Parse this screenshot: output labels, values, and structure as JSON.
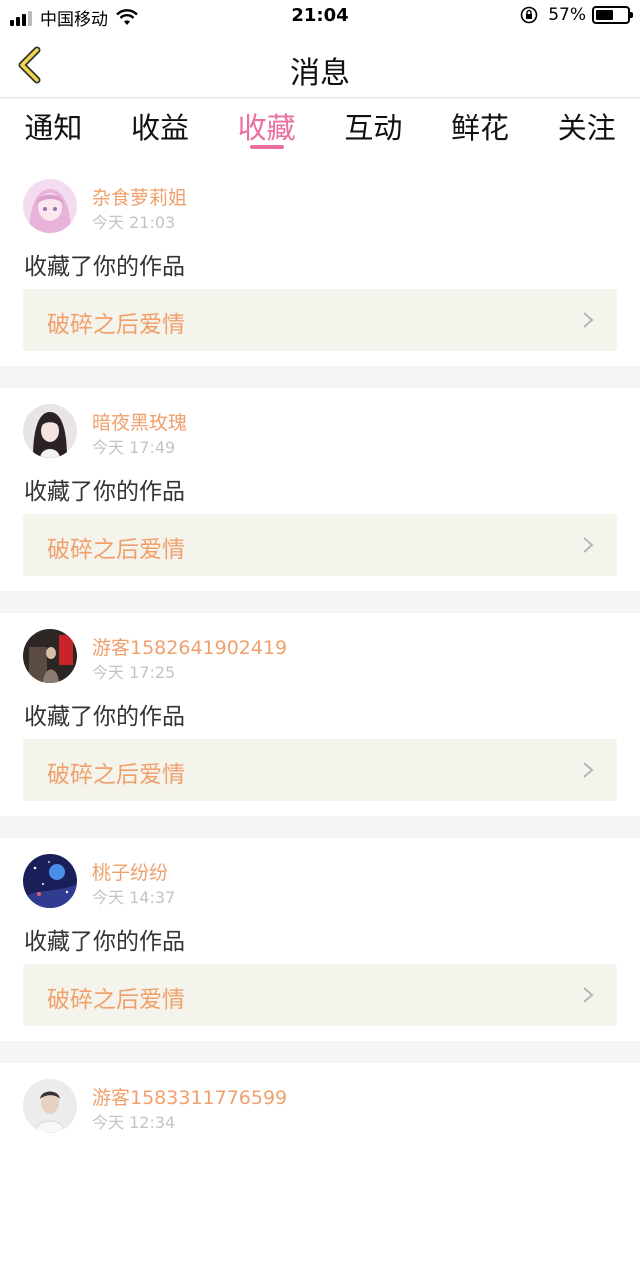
{
  "status_bar": {
    "carrier": "中国移动",
    "time": "21:04",
    "battery": "57%",
    "battery_level": 0.57
  },
  "nav": {
    "title": "消息",
    "back_icon": "chevron-left-icon"
  },
  "tabs": [
    {
      "label": "通知",
      "active": false
    },
    {
      "label": "收益",
      "active": false
    },
    {
      "label": "收藏",
      "active": true
    },
    {
      "label": "互动",
      "active": false
    },
    {
      "label": "鲜花",
      "active": false
    },
    {
      "label": "关注",
      "active": false
    }
  ],
  "colors": {
    "accent_pink": "#ea6fa1",
    "username_orange": "#f0a06d",
    "card_link_bg": "#f4f4ec"
  },
  "messages": [
    {
      "username": "杂食萝莉姐",
      "time": "今天 21:03",
      "action": "收藏了你的作品",
      "work_title": "破碎之后爱情"
    },
    {
      "username": "暗夜黑玫瑰",
      "time": "今天 17:49",
      "action": "收藏了你的作品",
      "work_title": "破碎之后爱情"
    },
    {
      "username": "游客1582641902419",
      "time": "今天 17:25",
      "action": "收藏了你的作品",
      "work_title": "破碎之后爱情"
    },
    {
      "username": "桃子纷纷",
      "time": "今天 14:37",
      "action": "收藏了你的作品",
      "work_title": "破碎之后爱情"
    },
    {
      "username": "游客1583311776599",
      "time": "今天 12:34",
      "action": "",
      "work_title": ""
    }
  ]
}
